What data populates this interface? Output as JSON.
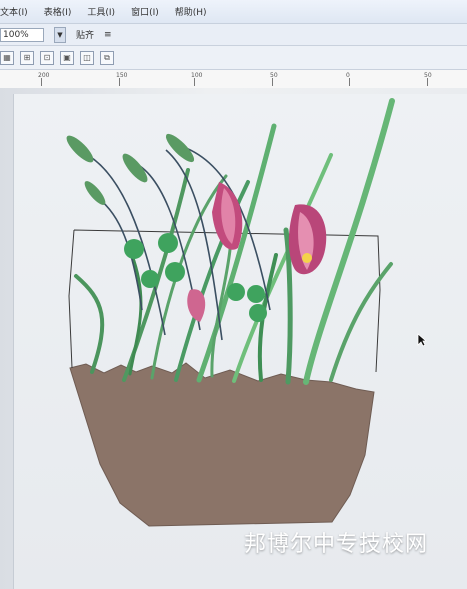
{
  "menu": {
    "items": [
      "文本(I)",
      "表格(I)",
      "工具(I)",
      "窗口(I)",
      "帮助(H)"
    ]
  },
  "toolbar": {
    "zoom_value": "100%",
    "align_label": "贴齐"
  },
  "ruler": {
    "labels": [
      "200",
      "150",
      "100",
      "50",
      "0",
      "50"
    ]
  },
  "watermark": {
    "text": "邦博尔中专技校网"
  },
  "icons": {
    "cursor": "arrow-pointer-icon"
  },
  "colors": {
    "soil": "#8b7468",
    "leaf": "#5aa36a",
    "flower": "#c24b7d"
  }
}
